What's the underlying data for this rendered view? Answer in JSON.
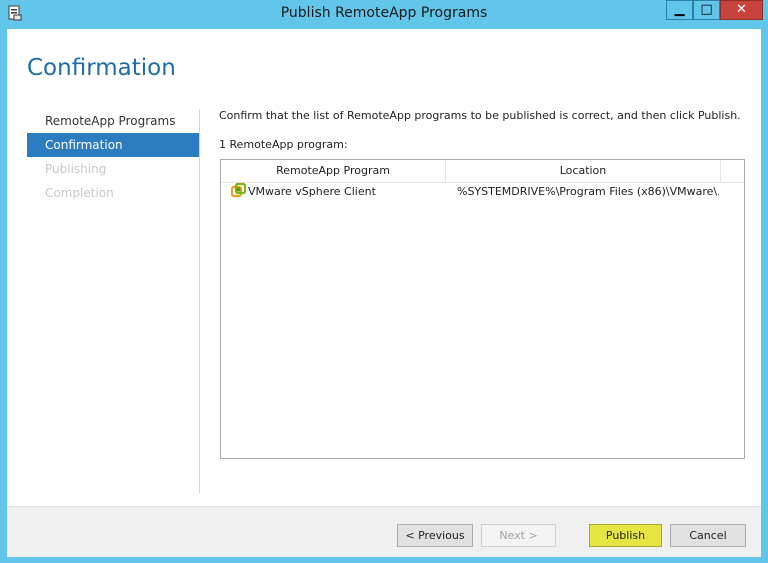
{
  "window": {
    "title": "Publish RemoteApp Programs",
    "controls": {
      "minimize": "▁",
      "maximize": "□",
      "close": "✕"
    }
  },
  "page": {
    "heading": "Confirmation"
  },
  "nav": {
    "items": [
      {
        "label": "RemoteApp Programs",
        "state": "normal"
      },
      {
        "label": "Confirmation",
        "state": "active"
      },
      {
        "label": "Publishing",
        "state": "disabled"
      },
      {
        "label": "Completion",
        "state": "disabled"
      }
    ]
  },
  "content": {
    "instruction": "Confirm that the list of RemoteApp programs to be published is correct, and then click Publish.",
    "count_label": "1 RemoteApp program:",
    "table": {
      "columns": [
        "RemoteApp Program",
        "Location"
      ],
      "rows": [
        {
          "program": "VMware vSphere Client",
          "location": "%SYSTEMDRIVE%\\Program Files (x86)\\VMware\\...",
          "icon": "vmware-vsphere-icon"
        }
      ]
    }
  },
  "buttons": {
    "previous": "< Previous",
    "next": "Next >",
    "publish": "Publish",
    "cancel": "Cancel"
  },
  "colors": {
    "titlebar": "#62c5ea",
    "heading": "#1e6fa8",
    "active_nav": "#2c7cc0",
    "publish_highlight": "#e6e643",
    "close_button": "#c7433b"
  }
}
